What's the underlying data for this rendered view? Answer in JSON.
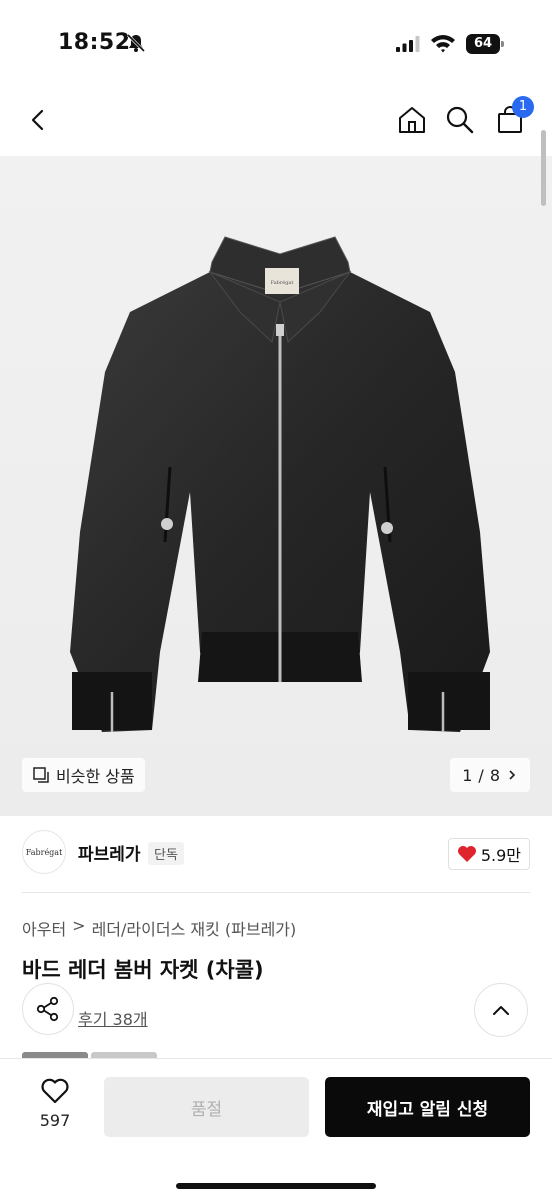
{
  "status_bar": {
    "time": "18:52",
    "battery": "64"
  },
  "nav": {
    "cart_count": "1"
  },
  "hero": {
    "similar_label": "비슷한 상품",
    "page_current": "1",
    "page_total": "8",
    "page_separator": "/",
    "jacket_label": "Fabrégat"
  },
  "brand": {
    "logo_text": "Fabrégat",
    "name": "파브레가",
    "badge": "단독",
    "likes": "5.9만"
  },
  "product": {
    "breadcrumb": [
      "아우터",
      "레더/라이더스 재킷 (파브레가)"
    ],
    "title": "바드 레더 봄버 자켓 (차콜)",
    "review_link": "후기 38개"
  },
  "bottom_bar": {
    "wish_count": "597",
    "soldout_label": "품절",
    "restock_label": "재입고 알림 신청"
  },
  "colors": {
    "accent_blue": "#2a6af0",
    "heart_red": "#e0242e",
    "cta_black": "#0a0a0a"
  }
}
